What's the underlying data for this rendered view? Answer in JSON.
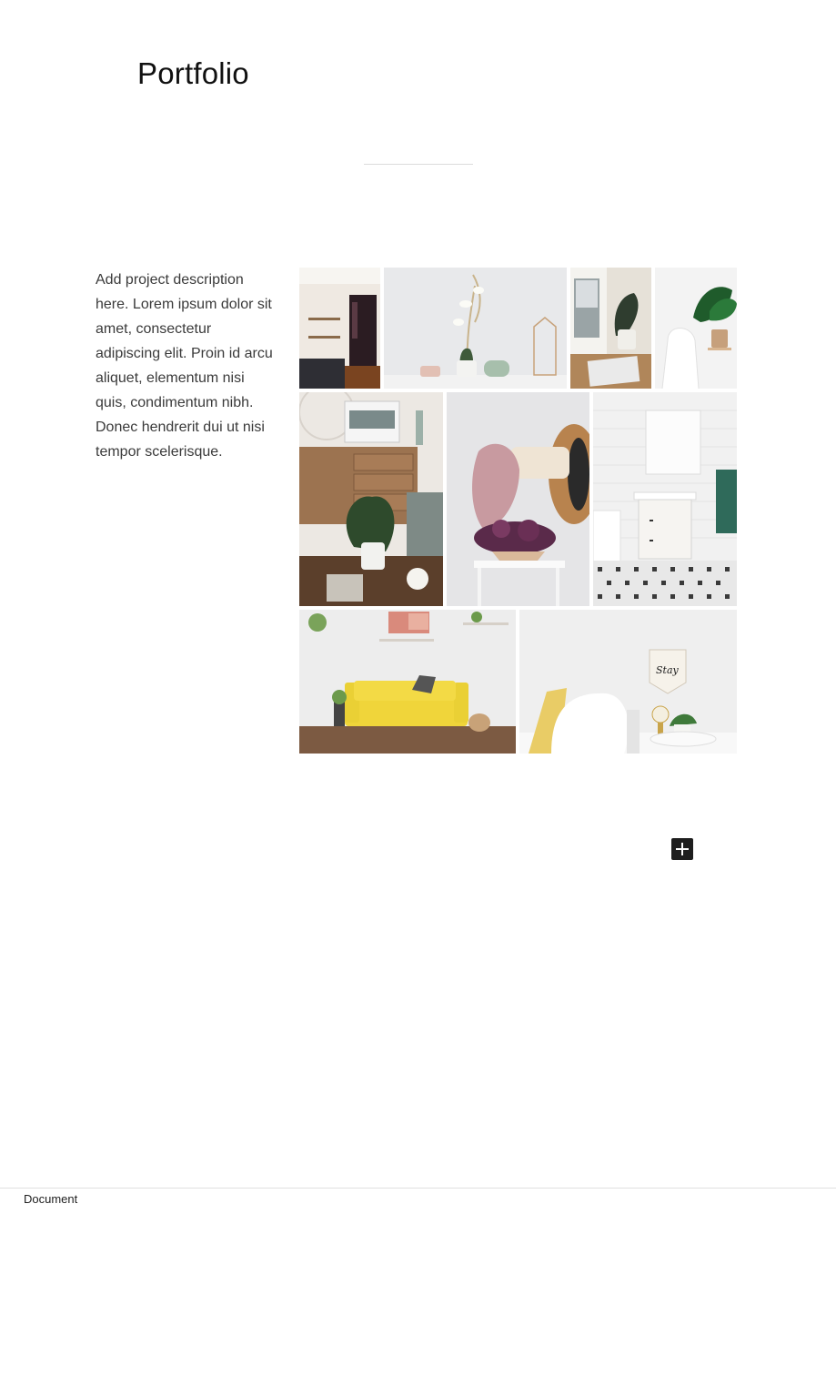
{
  "page": {
    "title": "Portfolio",
    "description": "Add project description here. Lorem ipsum dolor sit amet, consectetur adipiscing elit. Proin id arcu aliquet, elementum nisi quis, condimentum nibh. Donec hendrerit dui ut nisi tempor scelerisque."
  },
  "gallery": {
    "images": [
      {
        "subject": "kitchen-photo"
      },
      {
        "subject": "orchid-shelf-photo"
      },
      {
        "subject": "desk-plant-photo"
      },
      {
        "subject": "monstera-chair-photo"
      },
      {
        "subject": "sideboard-plant-photo"
      },
      {
        "subject": "lilac-chair-photo"
      },
      {
        "subject": "bathroom-vanity-photo"
      },
      {
        "subject": "yellow-sofa-photo"
      },
      {
        "subject": "bedroom-pillows-photo"
      }
    ]
  },
  "toolbar": {
    "add_block_icon": "plus-icon"
  },
  "footer": {
    "breadcrumb": "Document"
  },
  "colors": {
    "accent_dark": "#1e1e1e",
    "sofa_yellow": "#f0d53a"
  }
}
